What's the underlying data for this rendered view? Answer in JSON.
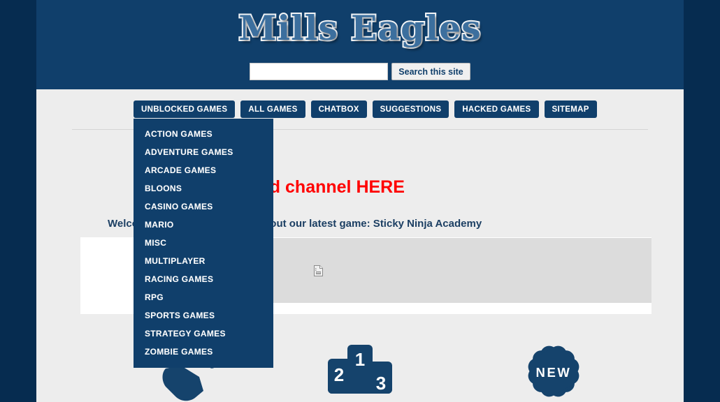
{
  "site": {
    "logo_text": "Mills Eagles",
    "brand_color": "#103f6b",
    "page_background": "#062c50",
    "content_background": "#ededed"
  },
  "search": {
    "value": "",
    "placeholder": "",
    "button_label": "Search this site"
  },
  "nav": {
    "items": [
      {
        "label": "UNBLOCKED GAMES",
        "name": "nav-unblocked-games"
      },
      {
        "label": "ALL GAMES",
        "name": "nav-all-games"
      },
      {
        "label": "CHATBOX",
        "name": "nav-chatbox"
      },
      {
        "label": "SUGGESTIONS",
        "name": "nav-suggestions"
      },
      {
        "label": "HACKED GAMES",
        "name": "nav-hacked-games"
      },
      {
        "label": "SITEMAP",
        "name": "nav-sitemap"
      }
    ]
  },
  "dropdown": {
    "open_for": "UNBLOCKED GAMES",
    "items": [
      {
        "label": "ACTION GAMES"
      },
      {
        "label": "ADVENTURE GAMES"
      },
      {
        "label": "ARCADE GAMES"
      },
      {
        "label": "BLOONS"
      },
      {
        "label": "CASINO GAMES"
      },
      {
        "label": "MARIO"
      },
      {
        "label": "MISC"
      },
      {
        "label": "MULTIPLAYER"
      },
      {
        "label": "RACING GAMES"
      },
      {
        "label": "RPG"
      },
      {
        "label": "SPORTS GAMES"
      },
      {
        "label": "STRATEGY GAMES"
      },
      {
        "label": "ZOMBIE GAMES"
      }
    ]
  },
  "main": {
    "headline": "NEW* Discord channel HERE",
    "headline_color": "#ff0000",
    "subtext": "Welcome to Mills Eagles! Check out our latest game: Sticky Ninja Academy",
    "image_placeholder_icon": "broken-image-icon"
  },
  "icons": {
    "hand": {
      "name": "hand-icon",
      "label": ""
    },
    "podium": {
      "name": "podium-icon",
      "first": "1",
      "second": "2",
      "third": "3"
    },
    "badge": {
      "name": "new-badge-icon",
      "label": "NEW"
    }
  }
}
